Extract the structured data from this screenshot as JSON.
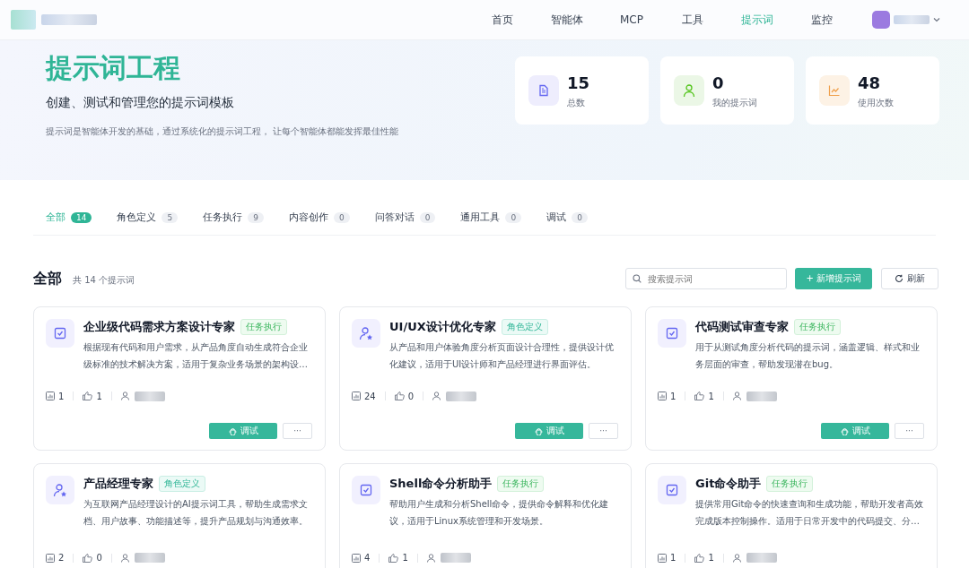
{
  "nav": {
    "items": [
      {
        "label": "首页",
        "selected": false
      },
      {
        "label": "智能体",
        "selected": false
      },
      {
        "label": "MCP",
        "selected": false
      },
      {
        "label": "工具",
        "selected": false
      },
      {
        "label": "提示词",
        "selected": true
      },
      {
        "label": "监控",
        "selected": false
      }
    ]
  },
  "hero": {
    "title": "提示词工程",
    "subtitle": "创建、测试和管理您的提示词模板",
    "description": "提示词是智能体开发的基础，通过系统化的提示词工程， 让每个智能体都能发挥最佳性能",
    "stats": [
      {
        "kind": "total",
        "value": "15",
        "label": "总数"
      },
      {
        "kind": "mine",
        "value": "0",
        "label": "我的提示词"
      },
      {
        "kind": "usage",
        "value": "48",
        "label": "使用次数"
      }
    ]
  },
  "tabs": [
    {
      "label": "全部",
      "count": "14",
      "selected": true
    },
    {
      "label": "角色定义",
      "count": "5",
      "selected": false
    },
    {
      "label": "任务执行",
      "count": "9",
      "selected": false
    },
    {
      "label": "内容创作",
      "count": "0",
      "selected": false
    },
    {
      "label": "问答对话",
      "count": "0",
      "selected": false
    },
    {
      "label": "通用工具",
      "count": "0",
      "selected": false
    },
    {
      "label": "调试",
      "count": "0",
      "selected": false
    }
  ],
  "section": {
    "title": "全部",
    "summary": "共 14 个提示词",
    "search": {
      "placeholder": "搜索提示词"
    },
    "add_button": "+ 新增提示词",
    "refresh_button": "刷新"
  },
  "cards": [
    {
      "kind": "task",
      "title": "企业级代码需求方案设计专家",
      "tag": "任务执行",
      "description": "根据现有代码和用户需求，从产品角度自动生成符合企业级标准的技术解决方案，适用于复杂业务场景的架构设…",
      "views": "1",
      "likes": "1",
      "actions": {
        "debug": "调试",
        "more": "···"
      }
    },
    {
      "kind": "role",
      "title": "UI/UX设计优化专家",
      "tag": "角色定义",
      "description": "从产品和用户体验角度分析页面设计合理性，提供设计优化建议，适用于UI设计师和产品经理进行界面评估。",
      "views": "24",
      "likes": "0",
      "actions": {
        "debug": "调试",
        "more": "···"
      }
    },
    {
      "kind": "task",
      "title": "代码测试审查专家",
      "tag": "任务执行",
      "description": "用于从测试角度分析代码的提示词，涵盖逻辑、样式和业务层面的审查，帮助发现潜在bug。",
      "views": "1",
      "likes": "1",
      "actions": {
        "debug": "调试",
        "more": "···"
      }
    },
    {
      "kind": "role",
      "title": "产品经理专家",
      "tag": "角色定义",
      "description": "为互联网产品经理设计的AI提示词工具，帮助生成需求文档、用户故事、功能描述等，提升产品规划与沟通效率。",
      "views": "2",
      "likes": "0"
    },
    {
      "kind": "task",
      "title": "Shell命令分析助手",
      "tag": "任务执行",
      "description": "帮助用户生成和分析Shell命令，提供命令解释和优化建议，适用于Linux系统管理和开发场景。",
      "views": "4",
      "likes": "1"
    },
    {
      "kind": "task",
      "title": "Git命令助手",
      "tag": "任务执行",
      "description": "提供常用Git命令的快速查询和生成功能，帮助开发者高效完成版本控制操作。适用于日常开发中的代码提交、分…",
      "views": "1",
      "likes": "1"
    }
  ]
}
